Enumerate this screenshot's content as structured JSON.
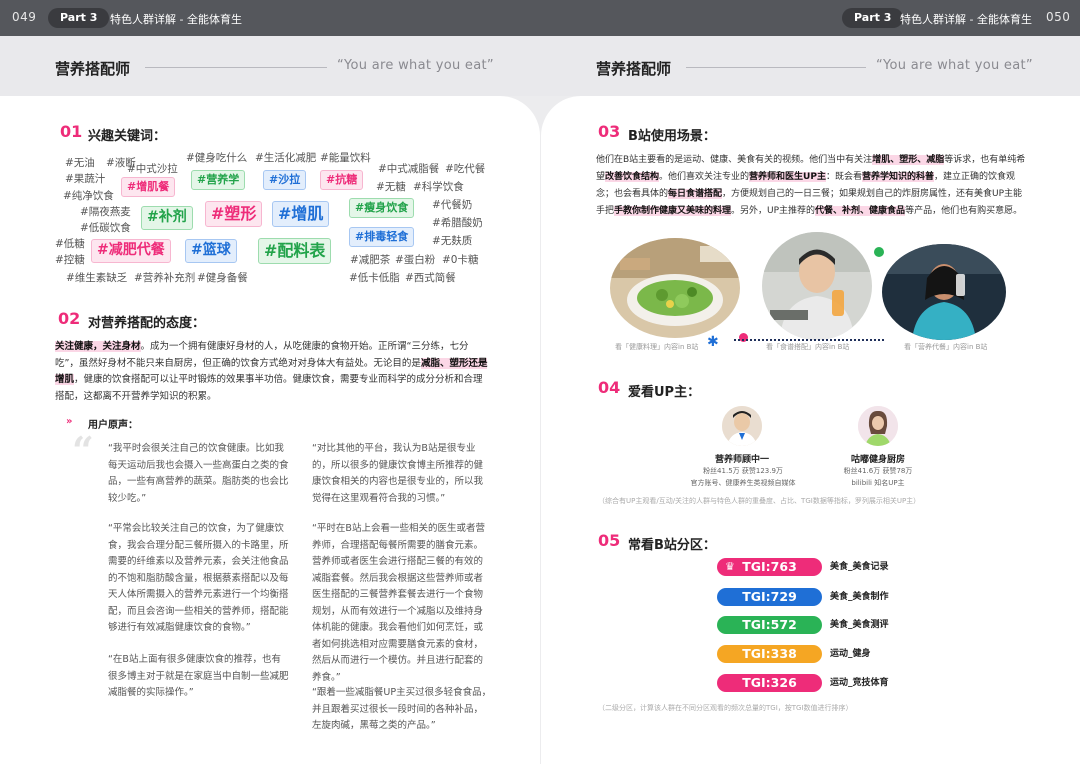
{
  "header": {
    "left_page": "049",
    "right_page": "050",
    "part": "Part 3",
    "title": "特色人群详解 - 全能体育生"
  },
  "section": {
    "title": "营养搭配师",
    "quote": "“You are what you eat”"
  },
  "s1": {
    "num": "01",
    "title": "兴趣关键词：",
    "tags": [
      "#无油",
      "#液断",
      "#果蔬汁",
      "#中式沙拉",
      "#纯净饮食",
      "#隔夜燕麦",
      "#低碳饮食",
      "#健身吃什么",
      "#生活化减肥",
      "#能量饮料",
      "#中式减脂餐",
      "#吃代餐",
      "#无糖",
      "#科学饮食",
      "#代餐奶",
      "#希腊酸奶",
      "#无麸质",
      "#低糖",
      "#控糖",
      "#减肥茶",
      "#蛋白粉",
      "#0卡糖",
      "#维生素缺乏",
      "#营养补充剂",
      "#健身备餐",
      "#低卡低脂",
      "#西式简餐"
    ],
    "boxed": {
      "zengji": "#增肌餐",
      "yingyang": "#营养学",
      "shala": "#沙拉",
      "kangtang": "#抗糖",
      "buji": "#补剂",
      "suxing": "#塑形",
      "zengji2": "#增肌",
      "shou": "#瘦身饮食",
      "paidu": "#排毒轻食",
      "jianfei": "#减肥代餐",
      "lanqiu": "#篮球",
      "peiliao": "#配料表"
    }
  },
  "s2": {
    "num": "02",
    "title": "对营养搭配的态度：",
    "p1_hl": "关注健康，关注身材",
    "p1_a": "。成为一个拥有健康好身材的人，从吃健康的食物开始。正所谓“三分练，七分吃”，虽然好身材不能只来自厨房，但正确的饮食方式绝对对身体大有益处。无论目的是",
    "p1_hl2": "减脂、塑形还是增肌",
    "p1_b": "，健康的饮食搭配可以让平时锻炼的效果事半功倍。健康饮食，需要专业而科学的成分分析和合理搭配，这都离不开营养学知识的积累。",
    "voice_label": "用户原声：",
    "quotes": [
      "“我平时会很关注自己的饮食健康。比如我每天运动后我也会摄入一些高蛋白之类的食品，一些有高营养的蔬菜。脂肪类的也会比较少吃。”",
      "“平常会比较关注自己的饮食，为了健康饮食，我会合理分配三餐所摄入的卡路里，所需要的纤维素以及营养元素，会关注他食品的不饱和脂肪酸含量，根据蔡素搭配以及每天人体所需摄入的营养元素进行一个均衡搭配，而且会咨询一些相关的营养师，搭配能够进行有效减脂健康饮食的食物。”",
      "“在B站上面有很多健康饮食的推荐，也有很多博主对于就是在家庭当中自制一些减肥减脂餐的实际操作。”",
      "“对比其他的平台，我认为B站是很专业的，所以很多的健康饮食博主所推荐的健康饮食相关的内容也是很专业的，所以我觉得在这里观看符合我的习惯。”",
      "“平时在B站上会看一些相关的医生或者营养师，合理搭配每餐所需要的膳食元素。营养师或者医生会进行搭配三餐的有效的减脂套餐。然后我会根据这些营养师或者医生搭配的三餐营养套餐去进行一个食物规划，从而有效进行一个减脂以及维持身体机能的健康。我会看他们如何烹饪，或者如何挑选相对应需要膳食元素的食材，然后从而进行一个模仿。并且进行配套的养食。”",
      "“跟着一些减脂餐UP主买过很多轻食食品，并且跟着买过很长一段时间的各种补品，左旋肉碱，黑莓之类的产品。”"
    ]
  },
  "s3": {
    "num": "03",
    "title": "B站使用场景：",
    "t1": "他们在B站主要看的是运动、健康、美食有关的视频。他们当中有关注",
    "h1": "增肌、塑形、减脂",
    "t2": "等诉求，也有单纯希望",
    "h2": "改善饮食结构",
    "t3": "。他们喜欢关注专业的",
    "h3": "营养师和医生UP主",
    "t4": "：既会看",
    "h4": "营养学知识的科普",
    "t5": "，建立正确的饮食观念；也会看具体的",
    "h5": "每日食谱搭配",
    "t6": "，方便规划自己的一日三餐；如果规划自己的炸厨房属性，还有美食UP主能手把",
    "h6": "手教你制作健康又美味的料理",
    "t7": "。另外，UP主推荐的",
    "h7": "代餐、补剂、健康食品",
    "t8": "等产品，他们也有购买意愿。",
    "captions": [
      "看「健康料理」内容in B站",
      "看「食谱搭配」内容in B站",
      "看「营养代餐」内容in B站"
    ]
  },
  "s4": {
    "num": "04",
    "title": "爱看UP主：",
    "ups": [
      {
        "name": "营养师顾中一",
        "line1": "粉丝41.5万  获赞123.9万",
        "line2": "官方账号、健康养生类视频自媒体"
      },
      {
        "name": "咕嘟健身厨房",
        "line1": "粉丝41.6万  获赞78万",
        "line2": "bilibili 知名UP主"
      }
    ],
    "note": "（综合有UP主观看/互动/关注的人群与特色人群的重叠度、占比、TGI数据等指标，罗列展示相关UP主）"
  },
  "s5": {
    "num": "05",
    "title": "常看B站分区：",
    "items": [
      {
        "tgi": "TGI:763",
        "label": "美食_美食记录",
        "color": "#ee2c79"
      },
      {
        "tgi": "TGI:729",
        "label": "美食_美食制作",
        "color": "#1f6fd6"
      },
      {
        "tgi": "TGI:572",
        "label": "美食_美食测评",
        "color": "#2ab356"
      },
      {
        "tgi": "TGI:338",
        "label": "运动_健身",
        "color": "#f5a623"
      },
      {
        "tgi": "TGI:326",
        "label": "运动_竞技体育",
        "color": "#ee2c79"
      }
    ],
    "note": "（二级分区，计算该人群在不同分区观看的频次总量的TGI，按TGI数值进行排序）"
  },
  "colors": {
    "accent": "#ee2c79",
    "header": "#55575c"
  }
}
